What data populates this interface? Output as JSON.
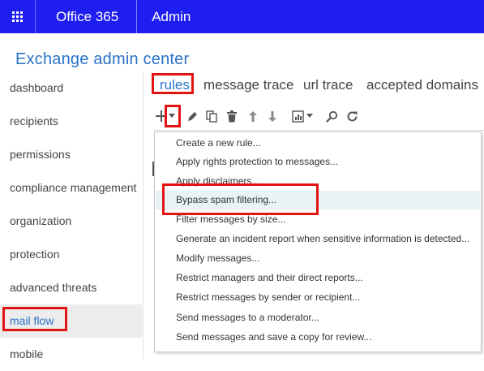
{
  "topbar": {
    "app_name": "Office 365",
    "section": "Admin"
  },
  "page_title": "Exchange admin center",
  "sidebar": {
    "items": [
      {
        "label": "dashboard"
      },
      {
        "label": "recipients"
      },
      {
        "label": "permissions"
      },
      {
        "label": "compliance management"
      },
      {
        "label": "organization"
      },
      {
        "label": "protection"
      },
      {
        "label": "advanced threats"
      },
      {
        "label": "mail flow",
        "selected": true
      },
      {
        "label": "mobile"
      }
    ]
  },
  "tabs": [
    {
      "label": "rules",
      "active": true
    },
    {
      "label": "message trace"
    },
    {
      "label": "url trace"
    },
    {
      "label": "accepted domains"
    }
  ],
  "toolbar": {
    "icons": [
      "add-icon",
      "dropdown-arrow-icon",
      "edit-icon",
      "copy-icon",
      "delete-icon",
      "up-arrow-icon",
      "down-arrow-icon",
      "report-icon",
      "search-icon",
      "refresh-icon"
    ]
  },
  "new_rule_menu": {
    "items": [
      {
        "label": "Create a new rule..."
      },
      {
        "label": "Apply rights protection to messages..."
      },
      {
        "label": "Apply disclaimers..."
      },
      {
        "label": "Bypass spam filtering...",
        "highlighted": true
      },
      {
        "label": "Filter messages by size..."
      },
      {
        "label": "Generate an incident report when sensitive information is detected..."
      },
      {
        "label": "Modify messages..."
      },
      {
        "label": "Restrict managers and their direct reports..."
      },
      {
        "label": "Restrict messages by sender or recipient..."
      },
      {
        "label": "Send messages to a moderator..."
      },
      {
        "label": "Send messages and save a copy for review..."
      }
    ]
  },
  "colors": {
    "topbar_bg": "#1e1ef0",
    "accent": "#2a72c8",
    "annotation_red": "#e41313",
    "menu_hover": "#e8f3f5",
    "nav_selected": "#ececec"
  }
}
